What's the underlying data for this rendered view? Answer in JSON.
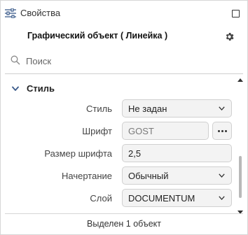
{
  "header": {
    "title": "Свойства",
    "icon": "properties-sliders-icon",
    "maximize_icon": "maximize-icon"
  },
  "object": {
    "title": "Графический объект ( Линейка )",
    "settings_icon": "gear-icon"
  },
  "search": {
    "placeholder": "Поиск",
    "value": ""
  },
  "section": {
    "label": "Стиль",
    "expanded": true
  },
  "properties": [
    {
      "label": "Стиль",
      "value": "Не задан",
      "kind": "select"
    },
    {
      "label": "Шрифт",
      "value": "GOST",
      "kind": "readonly-with-button"
    },
    {
      "label": "Размер шрифта",
      "value": "2,5",
      "kind": "text"
    },
    {
      "label": "Начертание",
      "value": "Обычный",
      "kind": "select"
    },
    {
      "label": "Слой",
      "value": "DOCUMENTUM",
      "kind": "select"
    }
  ],
  "status": {
    "text": "Выделен 1 объект"
  }
}
